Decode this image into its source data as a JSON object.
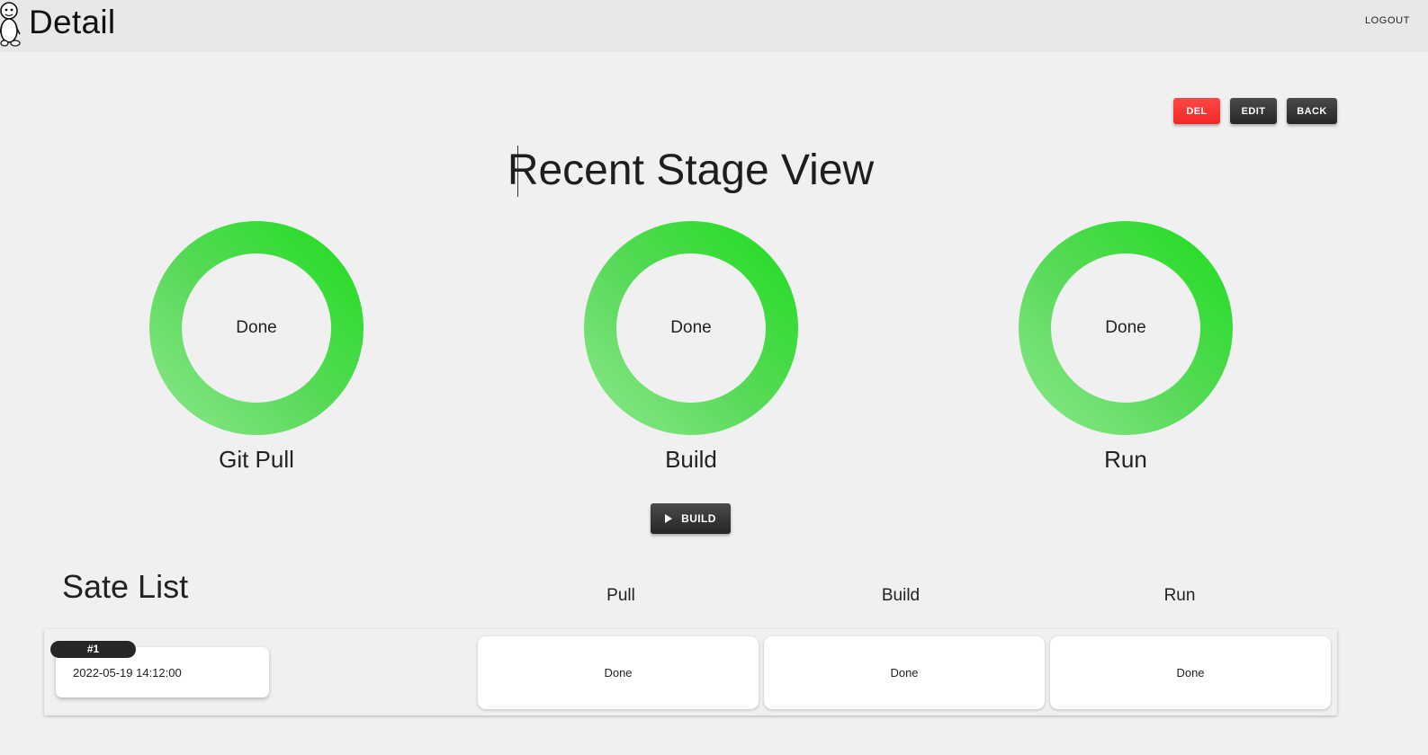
{
  "header": {
    "title": "Detail",
    "logout_label": "LOGOUT"
  },
  "actions": {
    "del_label": "DEL",
    "edit_label": "EDIT",
    "back_label": "BACK"
  },
  "stage_view": {
    "heading": "Recent Stage View",
    "stages": [
      {
        "name": "Git Pull",
        "status": "Done"
      },
      {
        "name": "Build",
        "status": "Done"
      },
      {
        "name": "Run",
        "status": "Done"
      }
    ],
    "build_button_label": "BUILD"
  },
  "stage_list": {
    "title": "Sate List",
    "columns": [
      "Pull",
      "Build",
      "Run"
    ],
    "rows": [
      {
        "badge": "#1",
        "date": "2022-05-19 14:12:00",
        "statuses": [
          "Done",
          "Done",
          "Done"
        ]
      }
    ]
  },
  "colors": {
    "danger": "#f22828",
    "dark": "#262626",
    "success": "#1ddd1d",
    "success_light": "#8ee88e"
  },
  "icons": {
    "build_button": "play-icon",
    "logo": "mascot-logo"
  }
}
